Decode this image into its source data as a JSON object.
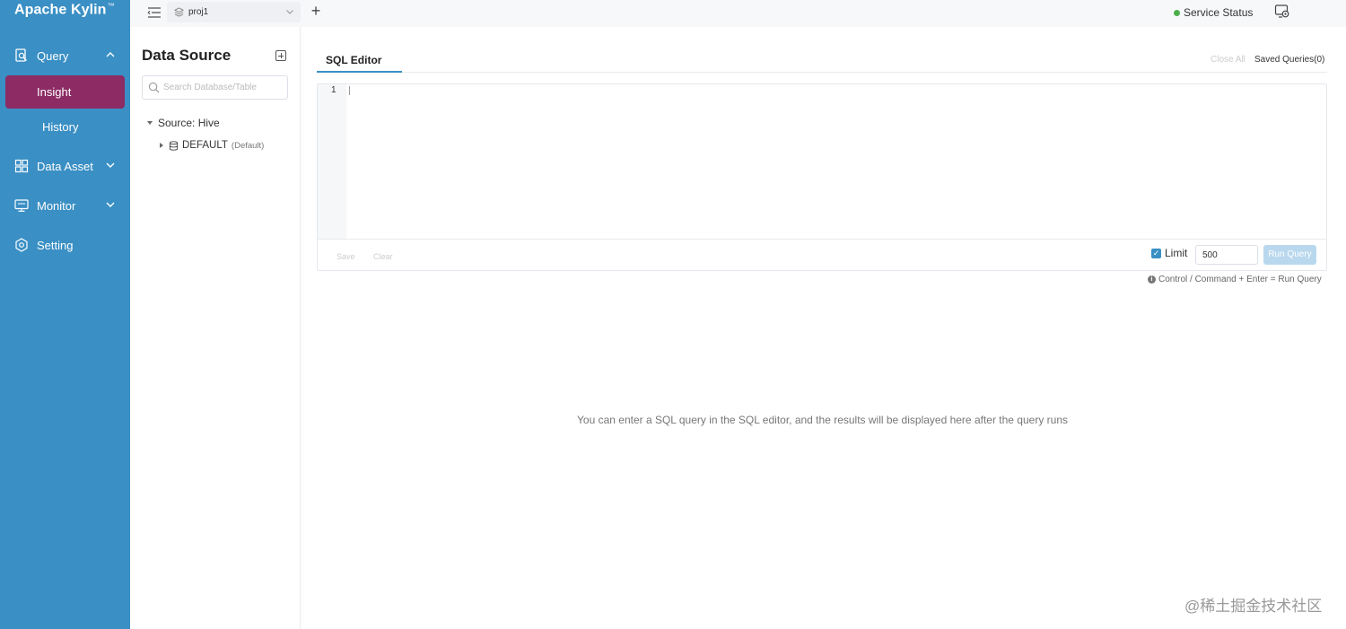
{
  "app": {
    "brand": "Apache Kylin",
    "brand_mark": "™"
  },
  "sidebar": {
    "items": [
      {
        "label": "Query",
        "icon": "query-icon",
        "expanded": true,
        "children": [
          {
            "label": "Insight",
            "active": true
          },
          {
            "label": "History",
            "active": false
          }
        ]
      },
      {
        "label": "Data Asset",
        "icon": "data-asset-icon"
      },
      {
        "label": "Monitor",
        "icon": "monitor-icon"
      },
      {
        "label": "Setting",
        "icon": "setting-icon"
      }
    ]
  },
  "topbar": {
    "project": "proj1",
    "service_status": "Service Status",
    "status_color": "#4cae4c"
  },
  "datasource": {
    "title": "Data Source",
    "search_placeholder": "Search Database/Table",
    "source_label": "Source: Hive",
    "database": "DEFAULT",
    "database_note": "(Default)"
  },
  "editor": {
    "tab": "SQL Editor",
    "close_all": "Close All",
    "saved_queries": "Saved Queries(0)",
    "line_number": "1",
    "save": "Save",
    "clear": "Clear",
    "limit_label": "Limit",
    "limit_checked": true,
    "limit_value": "500",
    "run_query": "Run Query",
    "hint": "Control / Command + Enter = Run Query"
  },
  "results": {
    "empty_message": "You can enter a SQL query in the SQL editor, and the results will be displayed here after the query runs"
  },
  "watermark": "@稀土掘金技术社区",
  "colors": {
    "sidebar": "#3a8fc4",
    "active_item": "#8c2b64",
    "accent": "#3a8fc4"
  }
}
